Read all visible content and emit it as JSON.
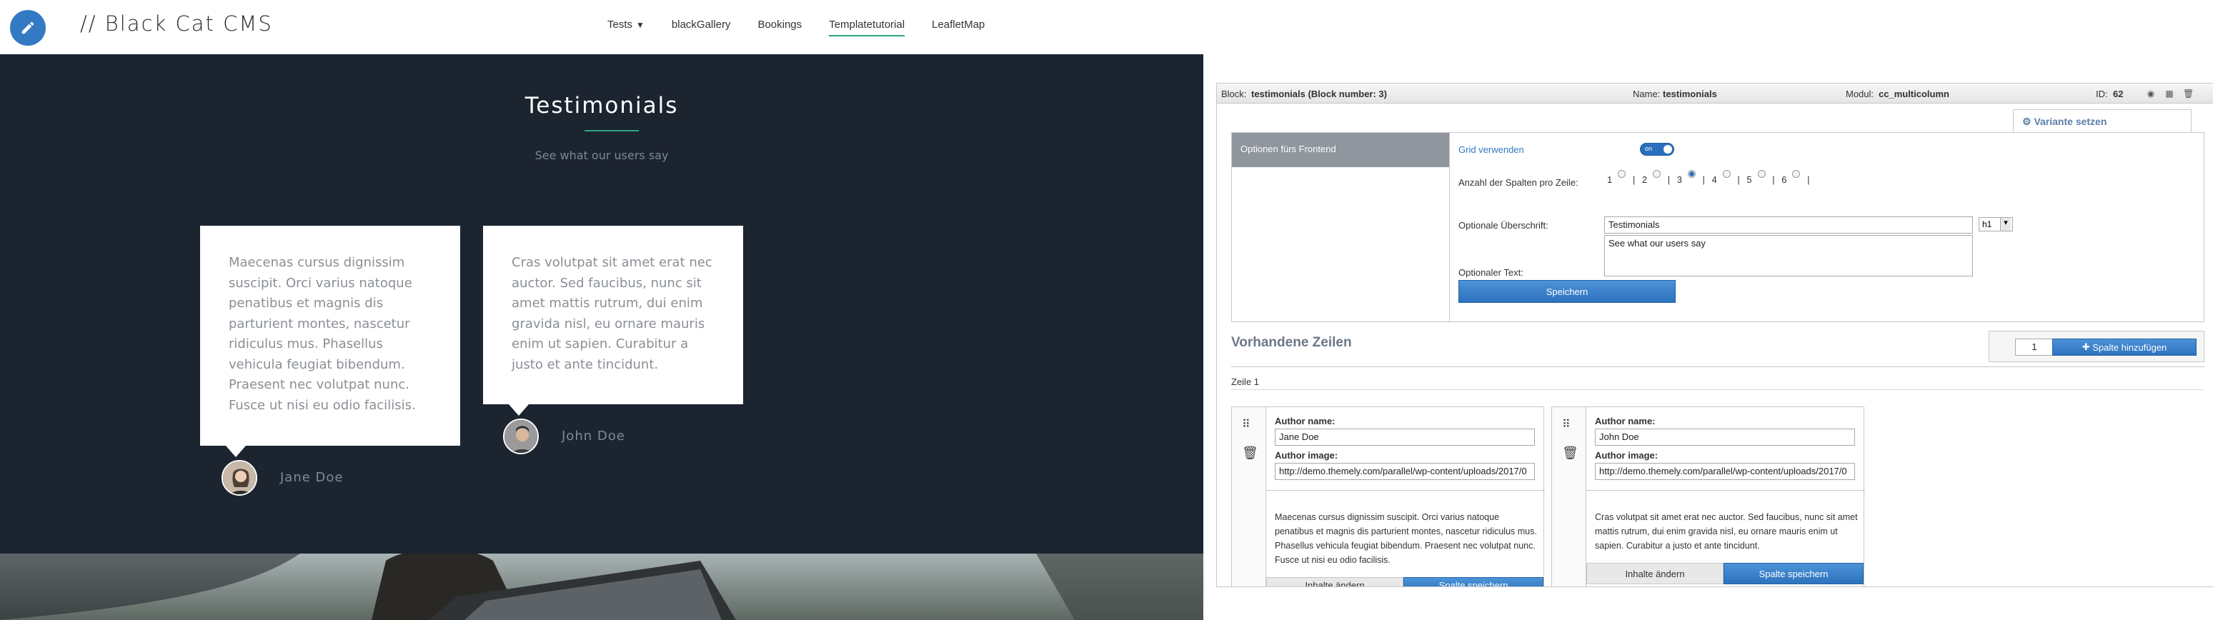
{
  "site": {
    "brand": "// Black Cat CMS",
    "nav": [
      {
        "label": "Tests",
        "has_dropdown": true
      },
      {
        "label": "blackGallery"
      },
      {
        "label": "Bookings"
      },
      {
        "label": "Templatetutorial",
        "active": true
      },
      {
        "label": "LeafletMap"
      }
    ],
    "hero": {
      "title": "Testimonials",
      "subtitle": "See what our users say"
    },
    "testimonials": [
      {
        "text": "Maecenas cursus dignissim suscipit. Orci varius natoque penatibus et magnis dis parturient montes, nascetur ridiculus mus. Phasellus vehicula feugiat bibendum. Praesent nec volutpat nunc. Fusce ut nisi eu odio facilisis.",
        "author": "Jane Doe"
      },
      {
        "text": "Cras volutpat sit amet erat nec auctor. Sed faucibus, nunc sit amet mattis rutrum, dui enim gravida nisl, eu ornare mauris enim ut sapien. Curabitur a justo et ante tincidunt.",
        "author": "John Doe"
      }
    ],
    "colors": {
      "accent": "#2aa57e",
      "dark_bg": "#1c2430",
      "logo_bg": "#3379c4"
    }
  },
  "cms": {
    "block_bar": {
      "block_label": "Block:",
      "block_value": "testimonials (Block number: 3)",
      "name_label": "Name:",
      "name_value": "testimonials",
      "modul_label": "Modul:",
      "modul_value": "cc_multicolumn",
      "id_label": "ID:",
      "id_value": "62",
      "icons": [
        "eye-icon",
        "calendar-icon",
        "trash-icon"
      ]
    },
    "variant_tab": "Variante setzen",
    "options": {
      "header": "Optionen fürs Frontend",
      "grid_label": "Grid verwenden",
      "grid_toggle": "on",
      "columns_label": "Anzahl der Spalten pro Zeile:",
      "column_options": [
        "1",
        "2",
        "3",
        "4",
        "5",
        "6"
      ],
      "column_selected": "3",
      "heading_label": "Optionale Überschrift:",
      "heading_value": "Testimonials",
      "heading_tag": "h1",
      "text_label": "Optionaler Text:",
      "text_value": "See what our users say",
      "save_button": "Speichern"
    },
    "rows_section": {
      "title": "Vorhandene Zeilen",
      "count_input": "1",
      "add_column_button": "Spalte hinzufügen",
      "row_label": "Zeile 1"
    },
    "columns": [
      {
        "author_name_label": "Author name:",
        "author_name": "Jane Doe",
        "author_image_label": "Author image:",
        "author_image": "http://demo.themely.com/parallel/wp-content/uploads/2017/0",
        "text": "Maecenas cursus dignissim suscipit. Orci varius natoque penatibus et magnis dis parturient montes, nascetur ridiculus mus. Phasellus vehicula feugiat bibendum. Praesent nec volutpat nunc. Fusce ut nisi eu odio facilisis.",
        "change_button": "Inhalte ändern",
        "save_button": "Spalte speichern"
      },
      {
        "author_name_label": "Author name:",
        "author_name": "John Doe",
        "author_image_label": "Author image:",
        "author_image": "http://demo.themely.com/parallel/wp-content/uploads/2017/0",
        "text": "Cras volutpat sit amet erat nec auctor. Sed faucibus, nunc sit amet mattis rutrum, dui enim gravida nisl, eu ornare mauris enim ut sapien. Curabitur a justo et ante tincidunt.",
        "change_button": "Inhalte ändern",
        "save_button": "Spalte speichern"
      }
    ]
  }
}
